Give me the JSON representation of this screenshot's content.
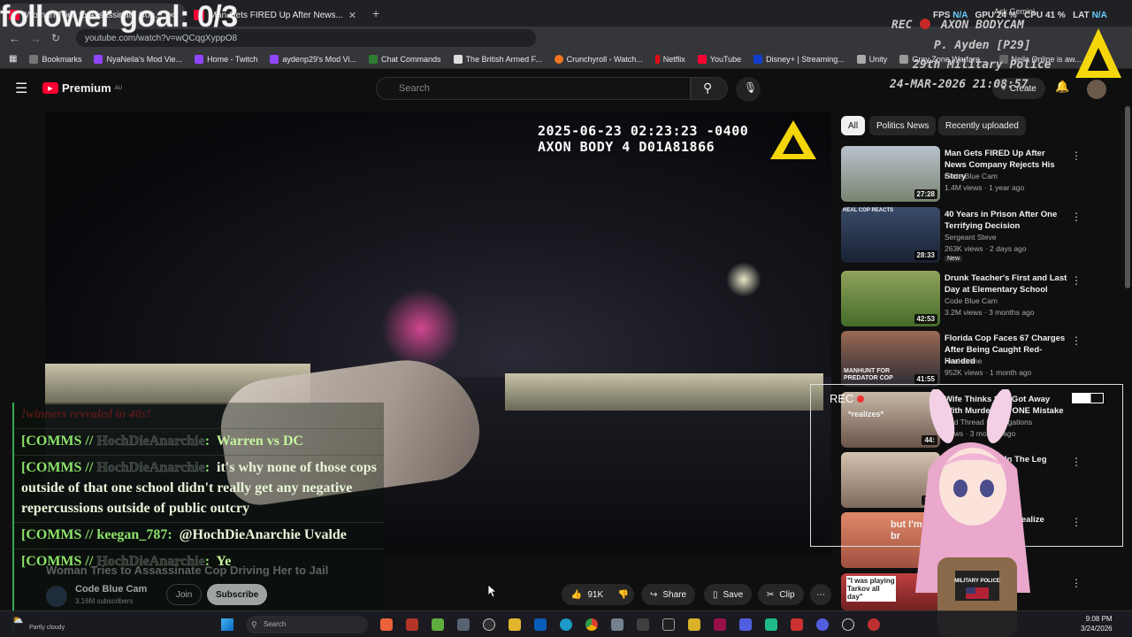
{
  "browser": {
    "tabs": [
      {
        "label": "Woman Tries to Assassinate Cop..."
      },
      {
        "label": "Man Gets FIRED Up After News..."
      }
    ],
    "address": "youtube.com/watch?v=wQCqgXyppO8",
    "bookmarks": [
      "Bookmarks",
      "NyaNeila's Mod Vie...",
      "Home - Twitch",
      "aydenp29's Mod Vi...",
      "Chat Commands",
      "The British Armed F...",
      "Crunchyroll - Watch...",
      "Netflix",
      "YouTube",
      "Disney+ | Streaming...",
      "Unity",
      "Gray Zone Warfare...",
      "Neila Online is aw..."
    ]
  },
  "youtube": {
    "logo": "Premium",
    "region": "AU",
    "search_placeholder": "Search",
    "create_label": "Create"
  },
  "video": {
    "timestamp": "2025-06-23 02:23:23 -0400",
    "device": "AXON BODY 4 D01A81866",
    "title": "Woman Tries to Assassinate Cop Driving Her to Jail",
    "channel": "Code Blue Cam",
    "subscribers": "3.16M subscribers",
    "join": "Join",
    "subscribe": "Subscribe",
    "likes": "91K",
    "share": "Share",
    "save": "Save",
    "clip": "Clip"
  },
  "chips": [
    "All",
    "Politics News",
    "Recently uploaded"
  ],
  "recommendations": [
    {
      "title": "Man Gets FIRED Up After News Company Rejects His Story",
      "channel": "Code Blue Cam",
      "meta": "1.4M views · 1 year ago",
      "duration": "27:28"
    },
    {
      "title": "40 Years in Prison After One Terrifying Decision",
      "channel": "Sergeant Steve",
      "meta": "263K views · 2 days ago",
      "duration": "28:33",
      "badge": "New",
      "thumb_text": "REAL COP REACTS"
    },
    {
      "title": "Drunk Teacher's First and Last Day at Elementary School",
      "channel": "Code Blue Cam",
      "meta": "3.2M views · 3 months ago",
      "duration": "42:53"
    },
    {
      "title": "Florida Cop Faces 67 Charges After Being Caught Red-Handed",
      "channel": "Real Crime",
      "meta": "952K views · 1 month ago",
      "duration": "41:55",
      "thumb_text": "MANHUNT FOR PREDATOR COP"
    },
    {
      "title": "Wife Thinks She Got Away With Murder But ONE Mistake",
      "channel": "Red Thread Investigations",
      "meta": "views · 3 months ago",
      "duration": "44:",
      "thumb_text": "*realizes*"
    },
    {
      "title": "In The Leg",
      "channel": "",
      "meta": "ago",
      "duration": "34:"
    },
    {
      "title": "Realize",
      "channel": "",
      "meta": "",
      "duration": "",
      "thumb_text": "but I'm 15 br"
    },
    {
      "title": "",
      "channel": "",
      "meta": "",
      "duration": "",
      "thumb_text": "\"I was playing Tarkov all day\""
    }
  ],
  "overlay": {
    "follower_goal": "follower goal: 0/3",
    "rec": "REC",
    "axon": "AXON BODYCAM",
    "officer": "P. Ayden [P29]",
    "unit": "29th Military Police",
    "datetime": "24-MAR-2026 21:08:57",
    "fps_label": "FPS",
    "fps": "N/A",
    "gpu_label": "GPU",
    "gpu": "24 %",
    "cpu_label": "CPU",
    "cpu": "41 %",
    "lat_label": "LAT",
    "lat": "N/A",
    "ask_gemini": "Ask Gemini",
    "cam_rec": "REC",
    "vtuber_badge": "MILITARY POLICE"
  },
  "chat": [
    {
      "prefix": "",
      "user": "",
      "text": "!winners revealed in 40s!"
    },
    {
      "prefix": "[COMMS // ",
      "user": "HochDieAnarchie",
      "text": "Warren vs DC"
    },
    {
      "prefix": "[COMMS // ",
      "user": "HochDieAnarchie",
      "text": "it's why none of those cops outside of that one school didn't really get any negative repercussions outside of public outcry"
    },
    {
      "prefix": "[COMMS // ",
      "user": "keegan_787",
      "text": "@HochDieAnarchie Uvalde"
    },
    {
      "prefix": "[COMMS // ",
      "user": "HochDieAnarchie",
      "text": "Ye"
    }
  ],
  "taskbar": {
    "weather": "Partly cloudy",
    "search": "Search",
    "time": "9:08 PM",
    "date": "3/24/2026"
  },
  "colors": {
    "yt_red": "#ff0033",
    "chat_green": "#8ce26a",
    "bg": "#0f0f0f"
  }
}
